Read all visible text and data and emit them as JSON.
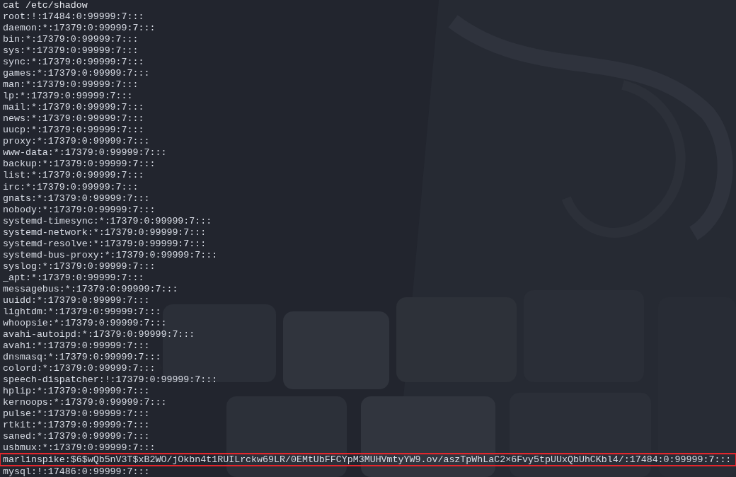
{
  "terminal": {
    "lines": [
      {
        "kind": "command",
        "text": "cat /etc/shadow",
        "highlighted": false
      },
      {
        "kind": "output",
        "text": "root:!:17484:0:99999:7:::",
        "highlighted": false
      },
      {
        "kind": "output",
        "text": "daemon:*:17379:0:99999:7:::",
        "highlighted": false
      },
      {
        "kind": "output",
        "text": "bin:*:17379:0:99999:7:::",
        "highlighted": false
      },
      {
        "kind": "output",
        "text": "sys:*:17379:0:99999:7:::",
        "highlighted": false
      },
      {
        "kind": "output",
        "text": "sync:*:17379:0:99999:7:::",
        "highlighted": false
      },
      {
        "kind": "output",
        "text": "games:*:17379:0:99999:7:::",
        "highlighted": false
      },
      {
        "kind": "output",
        "text": "man:*:17379:0:99999:7:::",
        "highlighted": false
      },
      {
        "kind": "output",
        "text": "lp:*:17379:0:99999:7:::",
        "highlighted": false
      },
      {
        "kind": "output",
        "text": "mail:*:17379:0:99999:7:::",
        "highlighted": false
      },
      {
        "kind": "output",
        "text": "news:*:17379:0:99999:7:::",
        "highlighted": false
      },
      {
        "kind": "output",
        "text": "uucp:*:17379:0:99999:7:::",
        "highlighted": false
      },
      {
        "kind": "output",
        "text": "proxy:*:17379:0:99999:7:::",
        "highlighted": false
      },
      {
        "kind": "output",
        "text": "www-data:*:17379:0:99999:7:::",
        "highlighted": false
      },
      {
        "kind": "output",
        "text": "backup:*:17379:0:99999:7:::",
        "highlighted": false
      },
      {
        "kind": "output",
        "text": "list:*:17379:0:99999:7:::",
        "highlighted": false
      },
      {
        "kind": "output",
        "text": "irc:*:17379:0:99999:7:::",
        "highlighted": false
      },
      {
        "kind": "output",
        "text": "gnats:*:17379:0:99999:7:::",
        "highlighted": false
      },
      {
        "kind": "output",
        "text": "nobody:*:17379:0:99999:7:::",
        "highlighted": false
      },
      {
        "kind": "output",
        "text": "systemd-timesync:*:17379:0:99999:7:::",
        "highlighted": false
      },
      {
        "kind": "output",
        "text": "systemd-network:*:17379:0:99999:7:::",
        "highlighted": false
      },
      {
        "kind": "output",
        "text": "systemd-resolve:*:17379:0:99999:7:::",
        "highlighted": false
      },
      {
        "kind": "output",
        "text": "systemd-bus-proxy:*:17379:0:99999:7:::",
        "highlighted": false
      },
      {
        "kind": "output",
        "text": "syslog:*:17379:0:99999:7:::",
        "highlighted": false
      },
      {
        "kind": "output",
        "text": "_apt:*:17379:0:99999:7:::",
        "highlighted": false
      },
      {
        "kind": "output",
        "text": "messagebus:*:17379:0:99999:7:::",
        "highlighted": false
      },
      {
        "kind": "output",
        "text": "uuidd:*:17379:0:99999:7:::",
        "highlighted": false
      },
      {
        "kind": "output",
        "text": "lightdm:*:17379:0:99999:7:::",
        "highlighted": false
      },
      {
        "kind": "output",
        "text": "whoopsie:*:17379:0:99999:7:::",
        "highlighted": false
      },
      {
        "kind": "output",
        "text": "avahi-autoipd:*:17379:0:99999:7:::",
        "highlighted": false
      },
      {
        "kind": "output",
        "text": "avahi:*:17379:0:99999:7:::",
        "highlighted": false
      },
      {
        "kind": "output",
        "text": "dnsmasq:*:17379:0:99999:7:::",
        "highlighted": false
      },
      {
        "kind": "output",
        "text": "colord:*:17379:0:99999:7:::",
        "highlighted": false
      },
      {
        "kind": "output",
        "text": "speech-dispatcher:!:17379:0:99999:7:::",
        "highlighted": false
      },
      {
        "kind": "output",
        "text": "hplip:*:17379:0:99999:7:::",
        "highlighted": false
      },
      {
        "kind": "output",
        "text": "kernoops:*:17379:0:99999:7:::",
        "highlighted": false
      },
      {
        "kind": "output",
        "text": "pulse:*:17379:0:99999:7:::",
        "highlighted": false
      },
      {
        "kind": "output",
        "text": "rtkit:*:17379:0:99999:7:::",
        "highlighted": false
      },
      {
        "kind": "output",
        "text": "saned:*:17379:0:99999:7:::",
        "highlighted": false
      },
      {
        "kind": "output",
        "text": "usbmux:*:17379:0:99999:7:::",
        "highlighted": false
      },
      {
        "kind": "output",
        "text": "marlinspike:$6$wQb5nV3T$xB2WO/jOkbn4t1RUILrckw69LR/0EMtUbFFCYpM3MUHVmtyYW9.ov/aszTpWhLaC2×6Fvy5tpUUxQbUhCKbl4/:17484:0:99999:7:::",
        "highlighted": true
      },
      {
        "kind": "output",
        "text": "mysql:!:17486:0:99999:7:::",
        "highlighted": false
      }
    ]
  }
}
